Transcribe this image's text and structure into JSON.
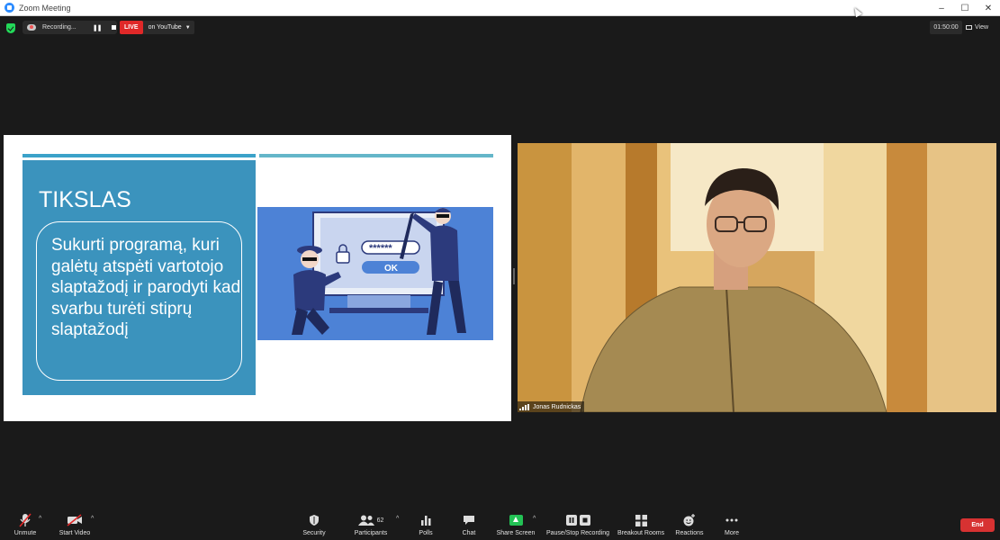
{
  "window": {
    "title": "Zoom Meeting",
    "controls": [
      "–",
      "☐",
      "✕"
    ]
  },
  "topbar": {
    "recording_label": "Recording...",
    "live_badge": "LIVE",
    "live_target": "on YouTube",
    "timer": "01:50:00",
    "view_label": "View"
  },
  "slide": {
    "title": "TIKSLAS",
    "body": "Sukurti programą, kuri galėtų atspėti vartotojo slaptažodį ir parodyti kad svarbu turėti stiprų slaptažodį",
    "illustration": {
      "password_mask": "******",
      "ok_label": "OK"
    }
  },
  "participant": {
    "name": "Jonas Rudnickas"
  },
  "toolbar": {
    "unmute": "Unmute",
    "start_video": "Start Video",
    "security": "Security",
    "participants": "Participants",
    "participants_count": "62",
    "polls": "Polls",
    "chat": "Chat",
    "share_screen": "Share Screen",
    "pause_stop_recording": "Pause/Stop Recording",
    "breakout_rooms": "Breakout Rooms",
    "reactions": "Reactions",
    "more": "More",
    "end": "End"
  },
  "colors": {
    "slide_panel": "#3b93bd",
    "live_red": "#e02828",
    "share_green": "#23c255",
    "end_red": "#d73232",
    "illustration_blue": "#4d82d6"
  }
}
